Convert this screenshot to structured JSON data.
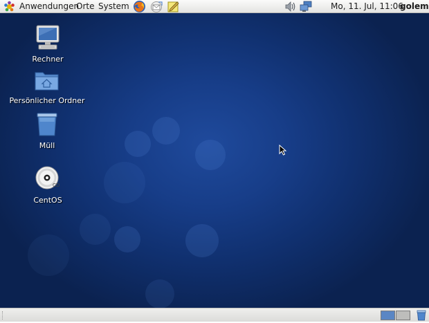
{
  "top_panel": {
    "menus": {
      "applications": "Anwendungen",
      "places": "Orte",
      "system": "System"
    },
    "launchers": [
      "firefox-icon",
      "mail-icon",
      "notes-icon"
    ],
    "clock": "Mo, 11. Jul, 11:06",
    "user": "golem"
  },
  "desktop": {
    "icons": [
      {
        "label": "Rechner",
        "icon": "computer-icon"
      },
      {
        "label": "Persönlicher Ordner",
        "icon": "home-folder-icon"
      },
      {
        "label": "Müll",
        "icon": "trash-icon"
      },
      {
        "label": "CentOS",
        "icon": "cd-icon"
      }
    ]
  },
  "colors": {
    "desktop_center": "#1f4a9c",
    "desktop_edge": "#0b2250",
    "panel": "#e9e9e7"
  }
}
